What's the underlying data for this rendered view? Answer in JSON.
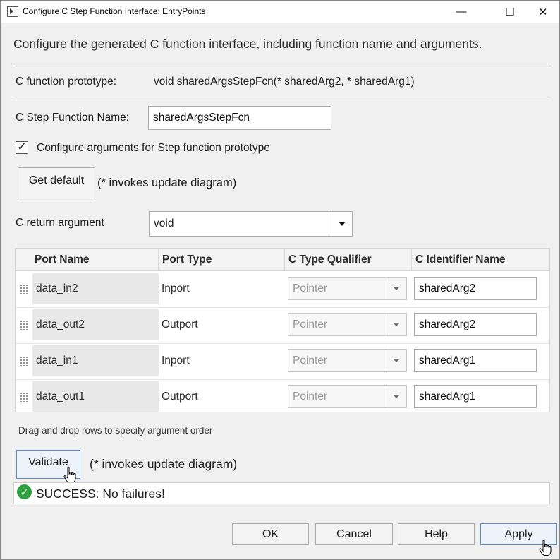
{
  "window": {
    "title": "Configure C Step Function Interface: EntryPoints",
    "minimize_glyph": "—",
    "maximize_glyph": "☐",
    "close_glyph": "✕"
  },
  "header": {
    "description": "Configure the generated C function interface, including function name and arguments."
  },
  "prototype": {
    "label": "C function prototype:",
    "value": "void sharedArgsStepFcn(* sharedArg2, * sharedArg1)"
  },
  "step_function": {
    "label": "C Step Function Name:",
    "value": "sharedArgsStepFcn"
  },
  "configure_args": {
    "checked": true,
    "check_glyph": "✓",
    "label": "Configure arguments for Step function prototype"
  },
  "get_default": {
    "button_label": "Get default",
    "note": "(* invokes update diagram)"
  },
  "return_arg": {
    "label": "C return argument",
    "value": "void"
  },
  "table": {
    "columns": [
      "Port Name",
      "Port Type",
      "C Type Qualifier",
      "C Identifier Name"
    ],
    "rows": [
      {
        "port_name": "data_in2",
        "port_type": "Inport",
        "qualifier": "Pointer",
        "identifier": "sharedArg2"
      },
      {
        "port_name": "data_out2",
        "port_type": "Outport",
        "qualifier": "Pointer",
        "identifier": "sharedArg2"
      },
      {
        "port_name": "data_in1",
        "port_type": "Inport",
        "qualifier": "Pointer",
        "identifier": "sharedArg1"
      },
      {
        "port_name": "data_out1",
        "port_type": "Outport",
        "qualifier": "Pointer",
        "identifier": "sharedArg1"
      }
    ],
    "hint": "Drag and drop rows to specify argument order"
  },
  "validate": {
    "button_label": "Validate",
    "note": "(* invokes update diagram)"
  },
  "status": {
    "icon": "success-check-icon",
    "icon_glyph": "✓",
    "text": "SUCCESS: No failures!"
  },
  "footer": {
    "ok": "OK",
    "cancel": "Cancel",
    "help": "Help",
    "apply": "Apply"
  },
  "colors": {
    "success": "#2e9e3e",
    "focus_border": "#5a8cd6"
  }
}
